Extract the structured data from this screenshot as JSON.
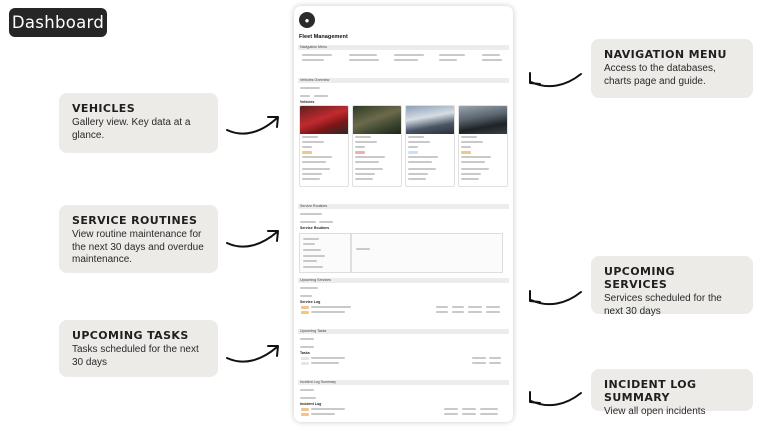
{
  "header": {
    "title": "Dashboard"
  },
  "callouts": {
    "vehicles": {
      "heading": "VEHICLES",
      "text": "Gallery view. Key data at a glance."
    },
    "service_routines": {
      "heading": "SERVICE ROUTINES",
      "text": "View routine maintenance for the next 30 days and overdue maintenance."
    },
    "upcoming_tasks": {
      "heading": "UPCOMING TASKS",
      "text": "Tasks scheduled for the next 30 days"
    },
    "navigation_menu": {
      "heading": "NAVIGATION MENU",
      "text": "Access to the databases, charts page and guide."
    },
    "upcoming_services": {
      "heading": "UPCOMING SERVICES",
      "text": "Services scheduled for the next 30 days"
    },
    "incident_log_summary": {
      "heading": "INCIDENT LOG SUMMARY",
      "text": "View all open incidents"
    }
  },
  "mockup": {
    "page_title": "Fleet Management",
    "sections": {
      "navigation": "Navigation Menu",
      "vehicles": "Vehicles Overview",
      "vehicles_db": "Vehicles",
      "service": "Service Routines",
      "service_db": "Service Routines",
      "upcoming_services": "Upcoming Services",
      "service_log": "Service Log",
      "upcoming_tasks": "Upcoming Tasks",
      "tasks_db": "Tasks",
      "incident": "Incident Log Summary",
      "incident_db": "Incident Log"
    },
    "vehicle_photo_colors": [
      "#b0282b",
      "#4a5a3a",
      "#5b6e85",
      "#2e3440"
    ]
  }
}
